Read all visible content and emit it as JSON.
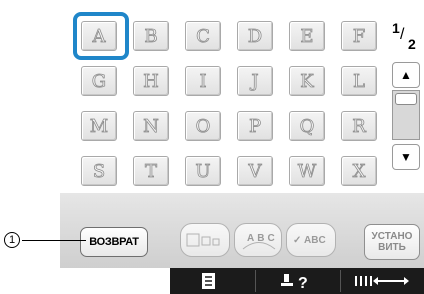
{
  "keys": [
    "A",
    "B",
    "C",
    "D",
    "E",
    "F",
    "G",
    "H",
    "I",
    "J",
    "K",
    "L",
    "M",
    "N",
    "O",
    "P",
    "Q",
    "R",
    "S",
    "T",
    "U",
    "V",
    "W",
    "X"
  ],
  "selected_key": "A",
  "page": {
    "current": "1",
    "total": "2"
  },
  "scroll": {
    "up_icon": "triangle-up-icon",
    "down_icon": "triangle-down-icon"
  },
  "buttons": {
    "back": "ВОЗВРАТ",
    "set_line1": "УСТАНО",
    "set_line2": "ВИТЬ",
    "mode_arc_text": "ABC",
    "mode_check_text": "ABC"
  },
  "callout": "1",
  "colors": {
    "selection": "#1f86c9",
    "bottom_bar": "#1b1b1b"
  }
}
